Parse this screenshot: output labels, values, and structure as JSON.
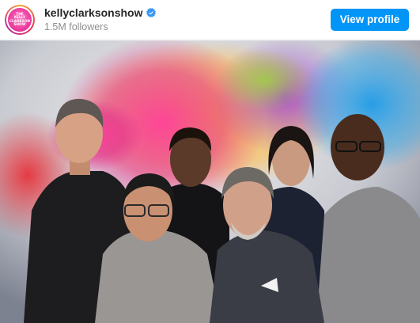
{
  "account": {
    "username": "kellyclarksonshow",
    "followers": "1.5M followers",
    "verified": true,
    "avatar_text": [
      "THE",
      "KELLY",
      "CLARKSON",
      "SHOW"
    ]
  },
  "actions": {
    "view_profile_label": "View profile"
  },
  "colors": {
    "button": "#0095f6",
    "username": "#262626",
    "subtext": "#8e8e8e",
    "verified": "#3897f0",
    "avatar_pink": "#ec3d9f"
  },
  "post": {
    "icons": [
      "verified-badge-icon"
    ]
  }
}
